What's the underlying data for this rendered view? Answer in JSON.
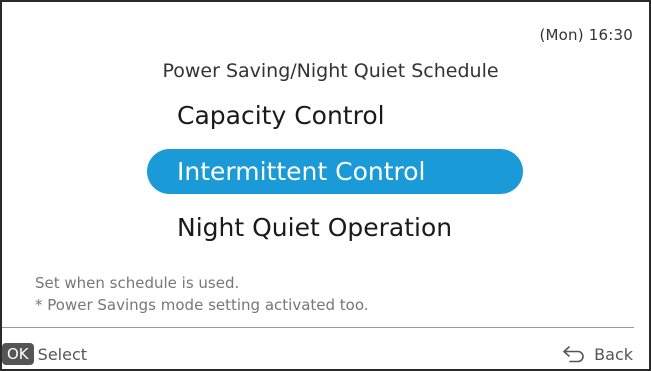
{
  "status": {
    "datetime": "(Mon) 16:30"
  },
  "menu": {
    "title": "Power Saving/Night Quiet Schedule",
    "items": [
      {
        "label": "Capacity Control",
        "selected": false
      },
      {
        "label": "Intermittent Control",
        "selected": true
      },
      {
        "label": "Night Quiet Operation",
        "selected": false
      }
    ]
  },
  "help": {
    "line1": "Set when schedule is used.",
    "line2": "* Power Savings mode setting activated too."
  },
  "footer": {
    "ok_badge": "OK",
    "select_label": "Select",
    "back_label": "Back"
  },
  "colors": {
    "selection": "#1a9ad6",
    "frame": "#2a2a2a",
    "hint_text": "#777777"
  },
  "icons": {
    "back": "return-arrow-icon"
  }
}
